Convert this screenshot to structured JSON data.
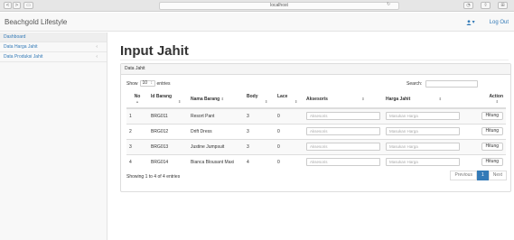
{
  "browser": {
    "url": "localhost",
    "nav_back": "<",
    "nav_forward": ">",
    "sidebar_toggle": "▭",
    "reload": "↻",
    "right_icons": [
      "◔",
      "⇧",
      "⊞"
    ]
  },
  "navbar": {
    "brand": "Beachgold Lifestyle",
    "user_caret": "▾",
    "logout": "Log Out"
  },
  "sidebar": {
    "items": [
      {
        "label": "Dashboard",
        "caret": ""
      },
      {
        "label": "Data Harga Jahit",
        "caret": "‹"
      },
      {
        "label": "Data Produksi Jahit",
        "caret": "‹"
      }
    ]
  },
  "page": {
    "title": "Input Jahit"
  },
  "panel": {
    "heading": "Data Jahit",
    "show_prefix": "Show",
    "show_value": "10",
    "show_suffix": "entries",
    "search_label": "Search:",
    "columns": [
      "No",
      "Id Barang",
      "Nama Barang",
      "Body",
      "Lace",
      "Aksesoris",
      "Harga Jahit",
      "Action"
    ],
    "rows": [
      {
        "no": "1",
        "id": "BRG011",
        "nama": "Resort Pant",
        "body": "3",
        "lace": "0",
        "aksesoris_ph": "Aksesoris",
        "harga_ph": "Masukan Harga",
        "action": "Hitung"
      },
      {
        "no": "2",
        "id": "BRG012",
        "nama": "Drift Dress",
        "body": "3",
        "lace": "0",
        "aksesoris_ph": "Aksesoris",
        "harga_ph": "Masukan Harga",
        "action": "Hitung"
      },
      {
        "no": "3",
        "id": "BRG013",
        "nama": "Justine Jumpsuit",
        "body": "3",
        "lace": "0",
        "aksesoris_ph": "Aksesoris",
        "harga_ph": "Masukan Harga",
        "action": "Hitung"
      },
      {
        "no": "4",
        "id": "BRG014",
        "nama": "Bianca Blousant Maxi",
        "body": "4",
        "lace": "0",
        "aksesoris_ph": "Aksesoris",
        "harga_ph": "Masukan Harga",
        "action": "Hitung"
      }
    ],
    "info": "Showing 1 to 4 of 4 entries",
    "pagination": {
      "previous": "Previous",
      "current": "1",
      "next": "Next"
    }
  },
  "colors": {
    "accent": "#337ab7",
    "navbar_bg": "#f8f8f8",
    "table_stripe": "#f9f9f9"
  }
}
